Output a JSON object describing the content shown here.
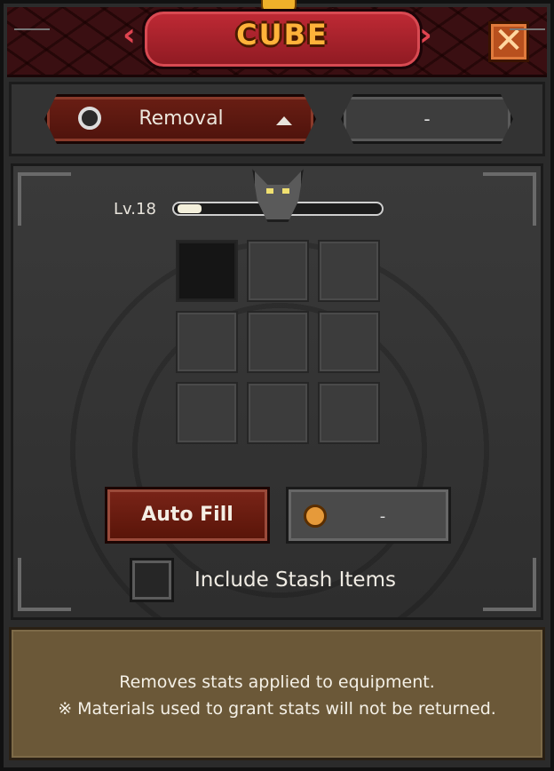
{
  "window": {
    "title": "CUBE",
    "close_glyph": "✕"
  },
  "tabs": {
    "selected": {
      "label": "Removal",
      "icon": "ring-icon",
      "caret": "caret-up-icon"
    },
    "second": {
      "label": "-"
    }
  },
  "level": {
    "label": "Lv.18",
    "progress": 0.12
  },
  "grid": {
    "slots": [
      {
        "state": "empty-dark"
      },
      {
        "state": "empty"
      },
      {
        "state": "empty"
      },
      {
        "state": "empty"
      },
      {
        "state": "empty"
      },
      {
        "state": "empty"
      },
      {
        "state": "empty"
      },
      {
        "state": "empty"
      },
      {
        "state": "empty"
      }
    ]
  },
  "actions": {
    "auto_fill_label": "Auto Fill",
    "cost_label": "-",
    "cost_icon": "coin-icon"
  },
  "stash": {
    "checkbox_label": "Include Stash Items",
    "checked": false
  },
  "description": {
    "line1": "Removes stats applied to equipment.",
    "line2": "※ Materials used to grant stats will not be returned."
  },
  "colors": {
    "title_text": "#ffb23a",
    "title_banner": "#c02a35",
    "selected_tab": "#6a1e14",
    "auto_fill_button": "#7a2418",
    "description_panel": "#6b5838"
  }
}
